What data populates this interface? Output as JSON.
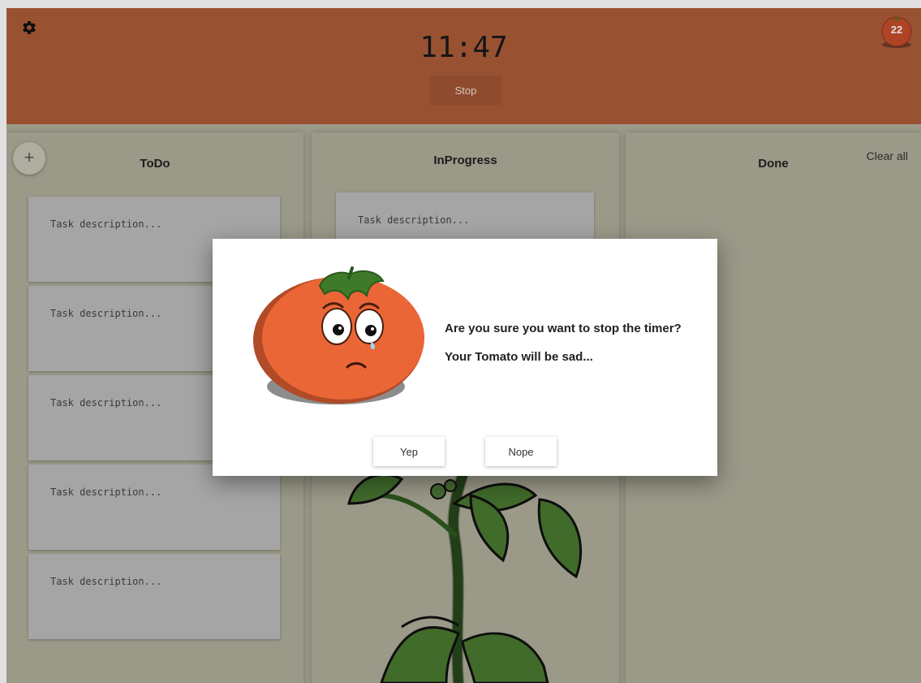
{
  "header": {
    "timer": "11:47",
    "stop_label": "Stop",
    "tomato_count": "22",
    "settings_icon": "gear-icon",
    "counter_icon": "tomato-icon"
  },
  "columns": [
    {
      "title": "ToDo",
      "cards": [
        "Task description...",
        "Task description...",
        "Task description...",
        "Task description...",
        "Task description..."
      ]
    },
    {
      "title": "InProgress",
      "cards": [
        "Task description..."
      ]
    },
    {
      "title": "Done",
      "cards": []
    }
  ],
  "todo_add_label": "+",
  "done_clear_label": "Clear all",
  "dialog": {
    "line1": "Are you sure you want to stop the timer?",
    "line2": "Your Tomato will be sad...",
    "yes_label": "Yep",
    "no_label": "Nope"
  },
  "colors": {
    "header": "#ad5e3a",
    "board": "#b3b29f",
    "tomato": "#e8643a",
    "leaf": "#3f7a2b"
  }
}
